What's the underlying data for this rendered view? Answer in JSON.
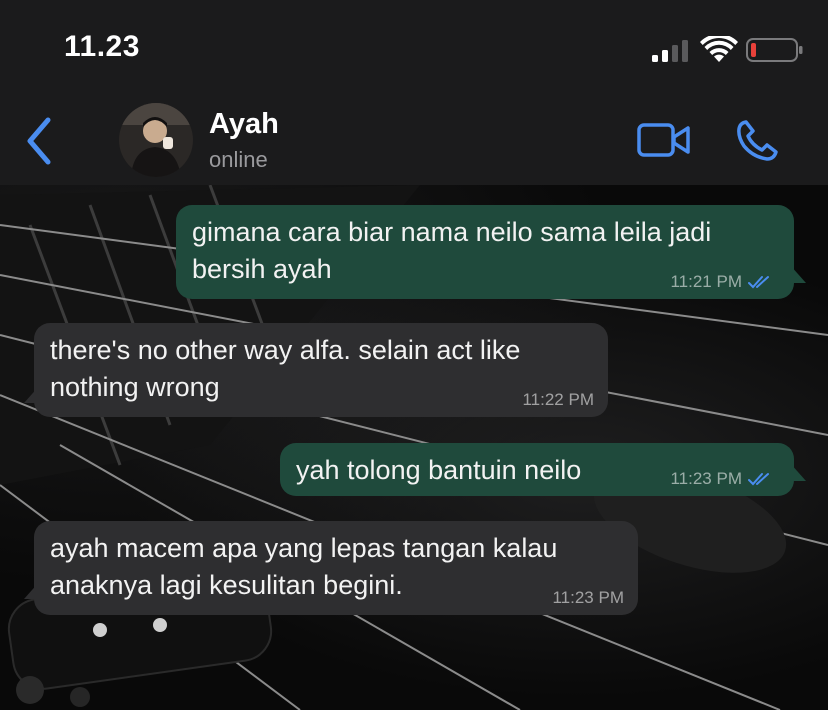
{
  "status_bar": {
    "time": "11.23",
    "icons": [
      "cellular-signal-icon",
      "wifi-icon",
      "battery-low-icon"
    ]
  },
  "header": {
    "contact_name": "Ayah",
    "contact_status": "online",
    "icons": [
      "chevron-left-icon",
      "avatar",
      "video-camera-icon",
      "phone-icon"
    ],
    "accent_color": "#4a8df0"
  },
  "messages": [
    {
      "direction": "outgoing",
      "lines": [
        "gimana cara biar nama neilo sama leila jadi",
        "bersih ayah"
      ],
      "time": "11:21 PM",
      "read": true
    },
    {
      "direction": "incoming",
      "lines": [
        "there's no other way alfa. selain act like",
        "nothing wrong"
      ],
      "time": "11:22 PM"
    },
    {
      "direction": "outgoing",
      "lines": [
        "yah tolong bantuin neilo"
      ],
      "time": "11:23 PM",
      "read": true
    },
    {
      "direction": "incoming",
      "lines": [
        "ayah macem apa yang lepas tangan kalau",
        "anaknya lagi kesulitan begini."
      ],
      "time": "11:23 PM"
    }
  ],
  "colors": {
    "outgoing_bubble": "#1f4a3c",
    "incoming_bubble": "#2e2e30",
    "read_ticks": "#4a8df0",
    "battery_low": "#e8413a"
  }
}
